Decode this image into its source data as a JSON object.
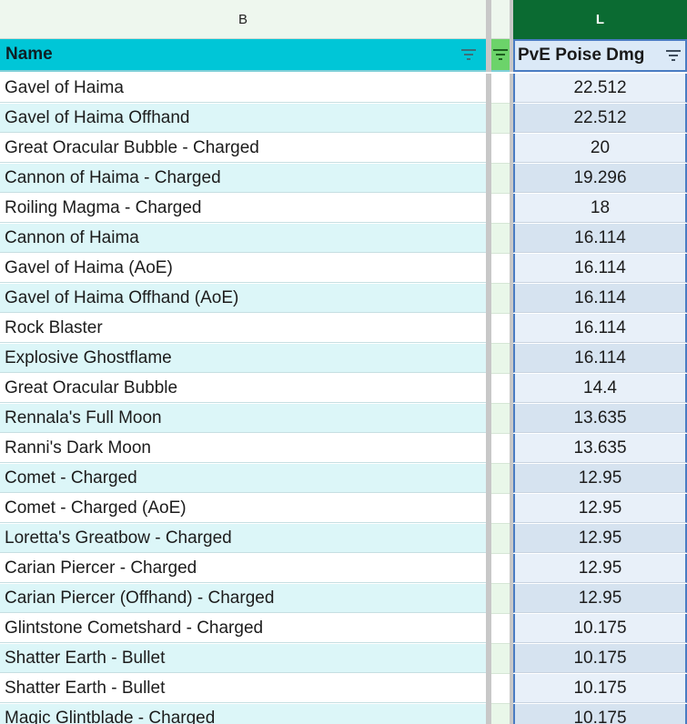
{
  "columns": {
    "b_letter": "B",
    "l_letter": "L",
    "b_header": "Name",
    "l_header": "PvE Poise Dmg"
  },
  "rows": [
    {
      "name": "Gavel of Haima",
      "value": "22.512"
    },
    {
      "name": "Gavel of Haima Offhand",
      "value": "22.512"
    },
    {
      "name": "Great Oracular Bubble - Charged",
      "value": "20"
    },
    {
      "name": "Cannon of Haima - Charged",
      "value": "19.296"
    },
    {
      "name": "Roiling Magma - Charged",
      "value": "18"
    },
    {
      "name": "Cannon of Haima",
      "value": "16.114"
    },
    {
      "name": "Gavel of Haima (AoE)",
      "value": "16.114"
    },
    {
      "name": "Gavel of Haima Offhand (AoE)",
      "value": "16.114"
    },
    {
      "name": "Rock Blaster",
      "value": "16.114"
    },
    {
      "name": "Explosive Ghostflame",
      "value": "16.114"
    },
    {
      "name": "Great Oracular Bubble",
      "value": "14.4"
    },
    {
      "name": "Rennala's Full Moon",
      "value": "13.635"
    },
    {
      "name": "Ranni's Dark Moon",
      "value": "13.635"
    },
    {
      "name": "Comet - Charged",
      "value": "12.95"
    },
    {
      "name": "Comet - Charged (AoE)",
      "value": "12.95"
    },
    {
      "name": "Loretta's Greatbow - Charged",
      "value": "12.95"
    },
    {
      "name": "Carian Piercer - Charged",
      "value": "12.95"
    },
    {
      "name": "Carian Piercer (Offhand) - Charged",
      "value": "12.95"
    },
    {
      "name": "Glintstone Cometshard - Charged",
      "value": "10.175"
    },
    {
      "name": "Shatter Earth - Bullet",
      "value": "10.175"
    },
    {
      "name": "Shatter Earth - Bullet",
      "value": "10.175"
    },
    {
      "name": "Magic Glintblade - Charged",
      "value": "10.175"
    }
  ],
  "icons": {
    "filter": "filter-icon"
  },
  "colors": {
    "selected_column_header": "#0b6b32",
    "name_header_bg": "#00c6d7",
    "alt_row_bg": "#dcf6f8",
    "selection_border": "#4a7cc2"
  }
}
